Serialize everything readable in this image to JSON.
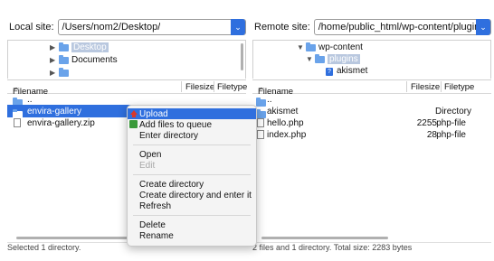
{
  "local": {
    "label": "Local site:",
    "path": "/Users/nom2/Desktop/",
    "tree": [
      {
        "name": "Desktop",
        "selected": true
      },
      {
        "name": "Documents",
        "selected": false
      }
    ],
    "columns": {
      "filename": "Filename",
      "filesize": "Filesize",
      "filetype": "Filetype"
    },
    "files": [
      {
        "name": "..",
        "type": "folder",
        "selected": false
      },
      {
        "name": "envira-gallery",
        "type": "folder",
        "selected": true
      },
      {
        "name": "envira-gallery.zip",
        "type": "file",
        "selected": false
      }
    ],
    "status": "Selected 1 directory."
  },
  "remote": {
    "label": "Remote site:",
    "path": "/home/public_html/wp-content/plugins",
    "tree": [
      {
        "name": "wp-content",
        "selected": false
      },
      {
        "name": "plugins",
        "selected": true
      },
      {
        "name": "akismet",
        "selected": false
      }
    ],
    "columns": {
      "filename": "Filename",
      "filesize": "Filesize",
      "filetype": "Filetype"
    },
    "files": [
      {
        "name": "..",
        "size": "",
        "type": ""
      },
      {
        "name": "akismet",
        "size": "",
        "type": "Directory"
      },
      {
        "name": "hello.php",
        "size": "2255",
        "type": "php-file"
      },
      {
        "name": "index.php",
        "size": "28",
        "type": "php-file"
      }
    ],
    "status": "2 files and 1 directory. Total size: 2283 bytes"
  },
  "context_menu": {
    "items": [
      {
        "label": "Upload",
        "icon": "upload-arrow-icon"
      },
      {
        "label": "Add files to queue",
        "icon": "add-queue-icon"
      },
      {
        "label": "Enter directory"
      },
      {
        "label": "Open"
      },
      {
        "label": "Edit",
        "disabled": true
      },
      {
        "label": "Create directory"
      },
      {
        "label": "Create directory and enter it"
      },
      {
        "label": "Refresh"
      },
      {
        "label": "Delete"
      },
      {
        "label": "Rename"
      }
    ]
  },
  "colors": {
    "accent": "#2f6fde",
    "selection_tree": "#b9c8df"
  }
}
